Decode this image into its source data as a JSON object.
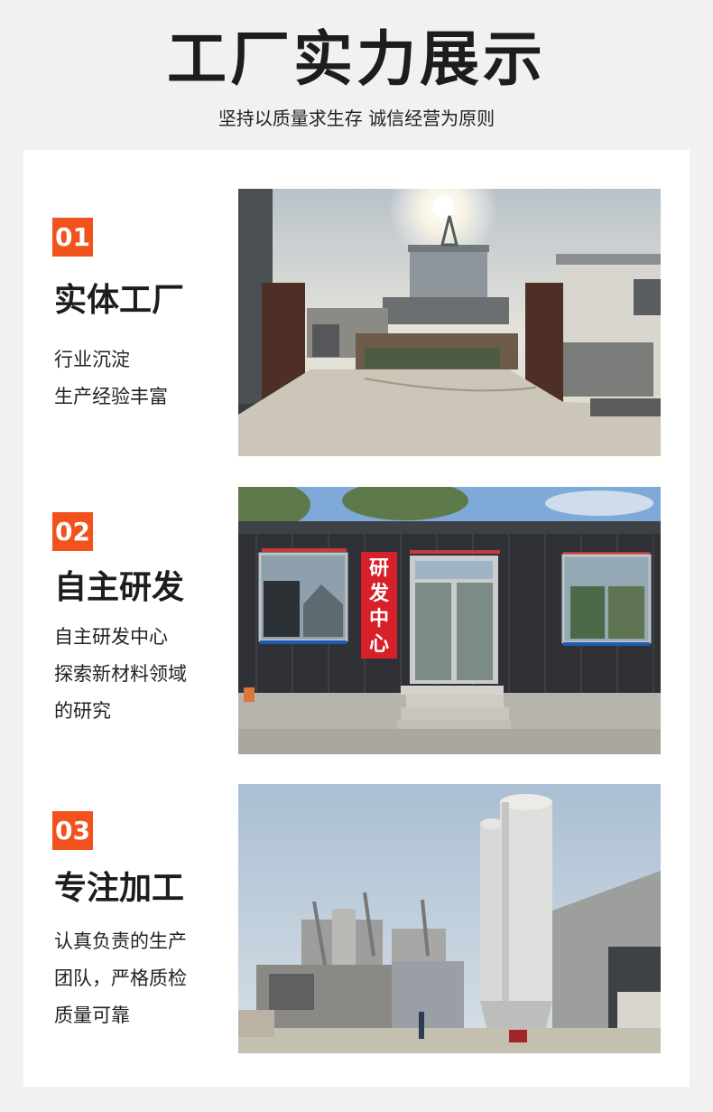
{
  "page": {
    "title": "工厂实力展示",
    "subtitle": "坚持以质量求生存 诚信经营为原则"
  },
  "sections": [
    {
      "number": "01",
      "heading": "实体工厂",
      "lines": [
        "行业沉淀",
        "生产经验丰富"
      ],
      "photo": "factory-gate-photo"
    },
    {
      "number": "02",
      "heading": "自主研发",
      "lines": [
        "自主研发中心",
        "探索新材料领域",
        "的研究"
      ],
      "photo": "rd-center-photo",
      "sign_text": [
        "研",
        "发",
        "中",
        "心"
      ]
    },
    {
      "number": "03",
      "heading": "专注加工",
      "lines": [
        "认真负责的生产",
        "团队，严格质检",
        "质量可靠"
      ],
      "photo": "processing-silos-photo"
    }
  ],
  "colors": {
    "accent": "#f1521e",
    "background": "#f1f1f1",
    "card": "#ffffff",
    "sign_red": "#d7202a"
  }
}
